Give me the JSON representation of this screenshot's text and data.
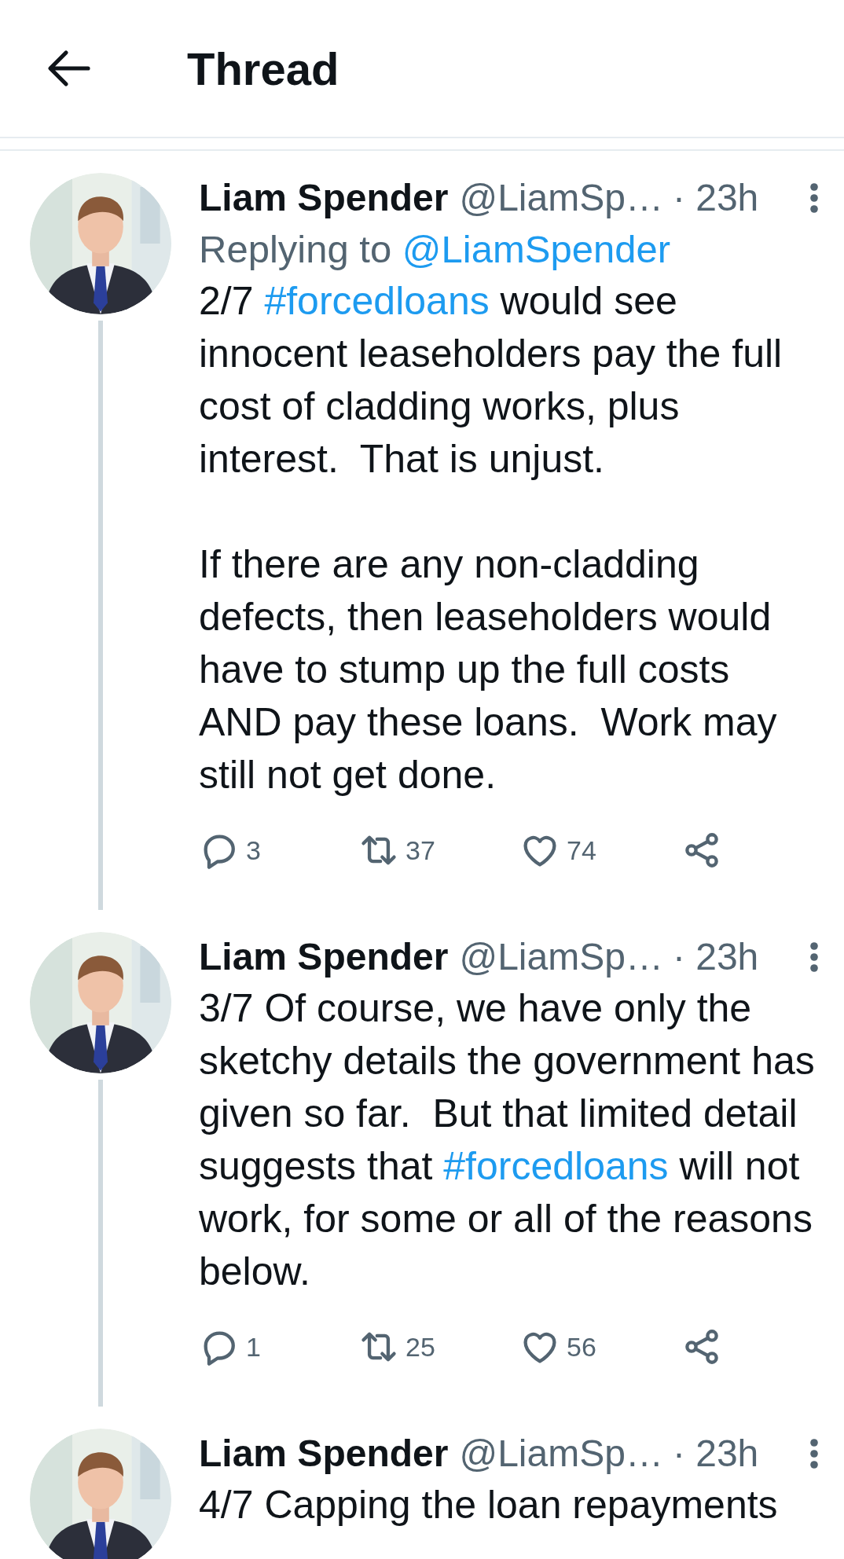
{
  "header": {
    "title": "Thread"
  },
  "tweets": [
    {
      "name": "Liam Spender",
      "handle": "@LiamSp…",
      "time": "· 23h",
      "reply_to": {
        "label": "Replying to",
        "handle": "@LiamSpender"
      },
      "paragraphs": [
        [
          {
            "kind": "text",
            "text": "2/7 "
          },
          {
            "kind": "hashtag",
            "text": "#forcedloans"
          },
          {
            "kind": "text",
            "text": " would see innocent leaseholders pay the full cost of cladding works, plus interest.  That is unjust."
          }
        ],
        [
          {
            "kind": "text",
            "text": "If there are any non-cladding defects, then leaseholders would have to stump up the full costs AND pay these loans.  Work may still not get done."
          }
        ]
      ],
      "actions": [
        {
          "kind": "reply",
          "count": "3"
        },
        {
          "kind": "retweet",
          "count": "37"
        },
        {
          "kind": "like",
          "count": "74"
        },
        {
          "kind": "share"
        }
      ]
    },
    {
      "name": "Liam Spender",
      "handle": "@LiamSp…",
      "time": "· 23h",
      "paragraphs": [
        [
          {
            "kind": "text",
            "text": "3/7 Of course, we have only the sketchy details the government has given so far.  But that limited detail suggests that "
          },
          {
            "kind": "hashtag",
            "text": "#forcedloans"
          },
          {
            "kind": "text",
            "text": " will not work, for some or all of the reasons below."
          }
        ]
      ],
      "actions": [
        {
          "kind": "reply",
          "count": "1"
        },
        {
          "kind": "retweet",
          "count": "25"
        },
        {
          "kind": "like",
          "count": "56"
        },
        {
          "kind": "share"
        }
      ]
    },
    {
      "name": "Liam Spender",
      "handle": "@LiamSp…",
      "time": "· 23h",
      "paragraphs": [
        [
          {
            "kind": "text",
            "text": "4/7 Capping the loan repayments"
          }
        ]
      ]
    }
  ]
}
